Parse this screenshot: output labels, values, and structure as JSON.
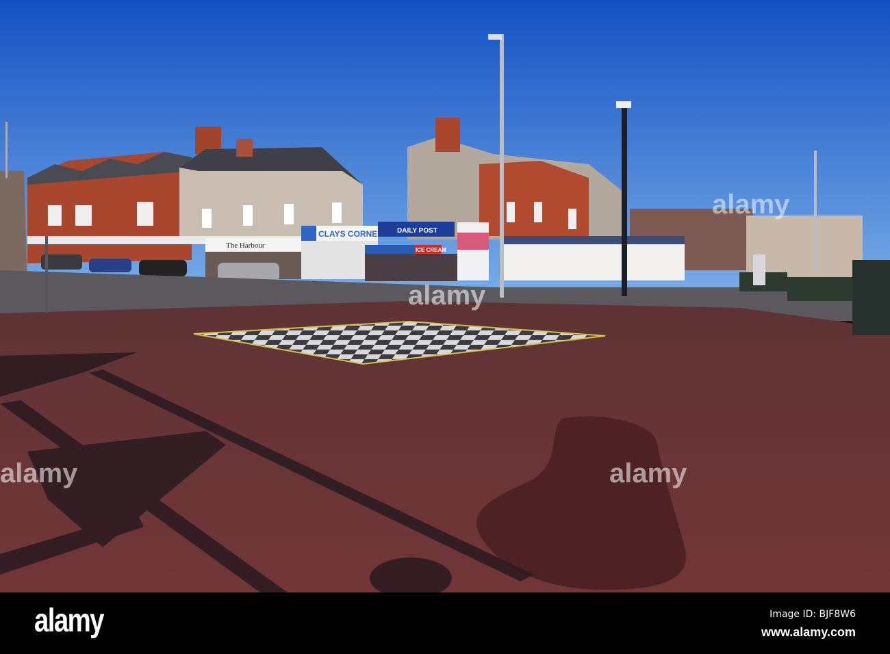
{
  "photo": {
    "signs": {
      "harbour": "The Harbour",
      "clays_corner": "CLAYS CORNER",
      "daily_post": "DAILY POST",
      "ice_cream": "ICE CREAM"
    },
    "colors": {
      "sky_top": "#1652c4",
      "sky_bottom": "#79ace6",
      "plaza": "#6b3536",
      "road": "#5c5a5d"
    }
  },
  "watermark": {
    "logo": "alamy",
    "center_text": "alamy",
    "image_id": "Image ID: BJF8W6",
    "url": "www.alamy.com"
  }
}
